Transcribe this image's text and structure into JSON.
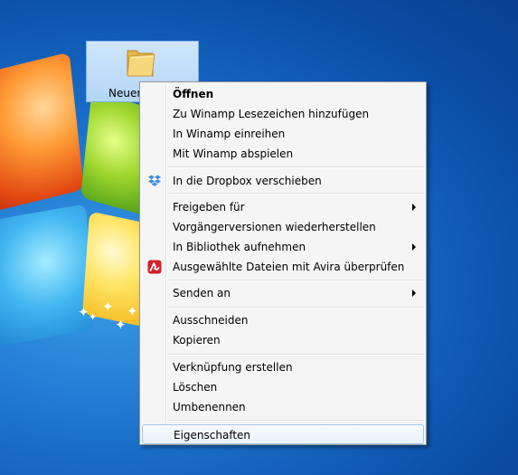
{
  "desktop": {
    "icon_label": "Neuer"
  },
  "menu": {
    "items": [
      {
        "label": "Öffnen"
      },
      {
        "label": "Zu Winamp Lesezeichen hinzufügen"
      },
      {
        "label": "In Winamp einreihen"
      },
      {
        "label": "Mit Winamp abspielen"
      },
      {
        "label": "In die Dropbox verschieben",
        "icon": "dropbox-icon"
      },
      {
        "label": "Freigeben für"
      },
      {
        "label": "Vorgängerversionen wiederherstellen"
      },
      {
        "label": "In Bibliothek aufnehmen"
      },
      {
        "label": "Ausgewählte Dateien mit Avira überprüfen",
        "icon": "avira-icon"
      },
      {
        "label": "Senden an"
      },
      {
        "label": "Ausschneiden"
      },
      {
        "label": "Kopieren"
      },
      {
        "label": "Verknüpfung erstellen"
      },
      {
        "label": "Löschen"
      },
      {
        "label": "Umbenennen"
      },
      {
        "label": "Eigenschaften"
      }
    ]
  },
  "colors": {
    "desktop_blue": "#1a6fc9",
    "menu_background": "#f5f5f5",
    "hover_border": "#a8c8ec",
    "dropbox_blue": "#3d8ee0",
    "avira_red": "#d51f26"
  }
}
